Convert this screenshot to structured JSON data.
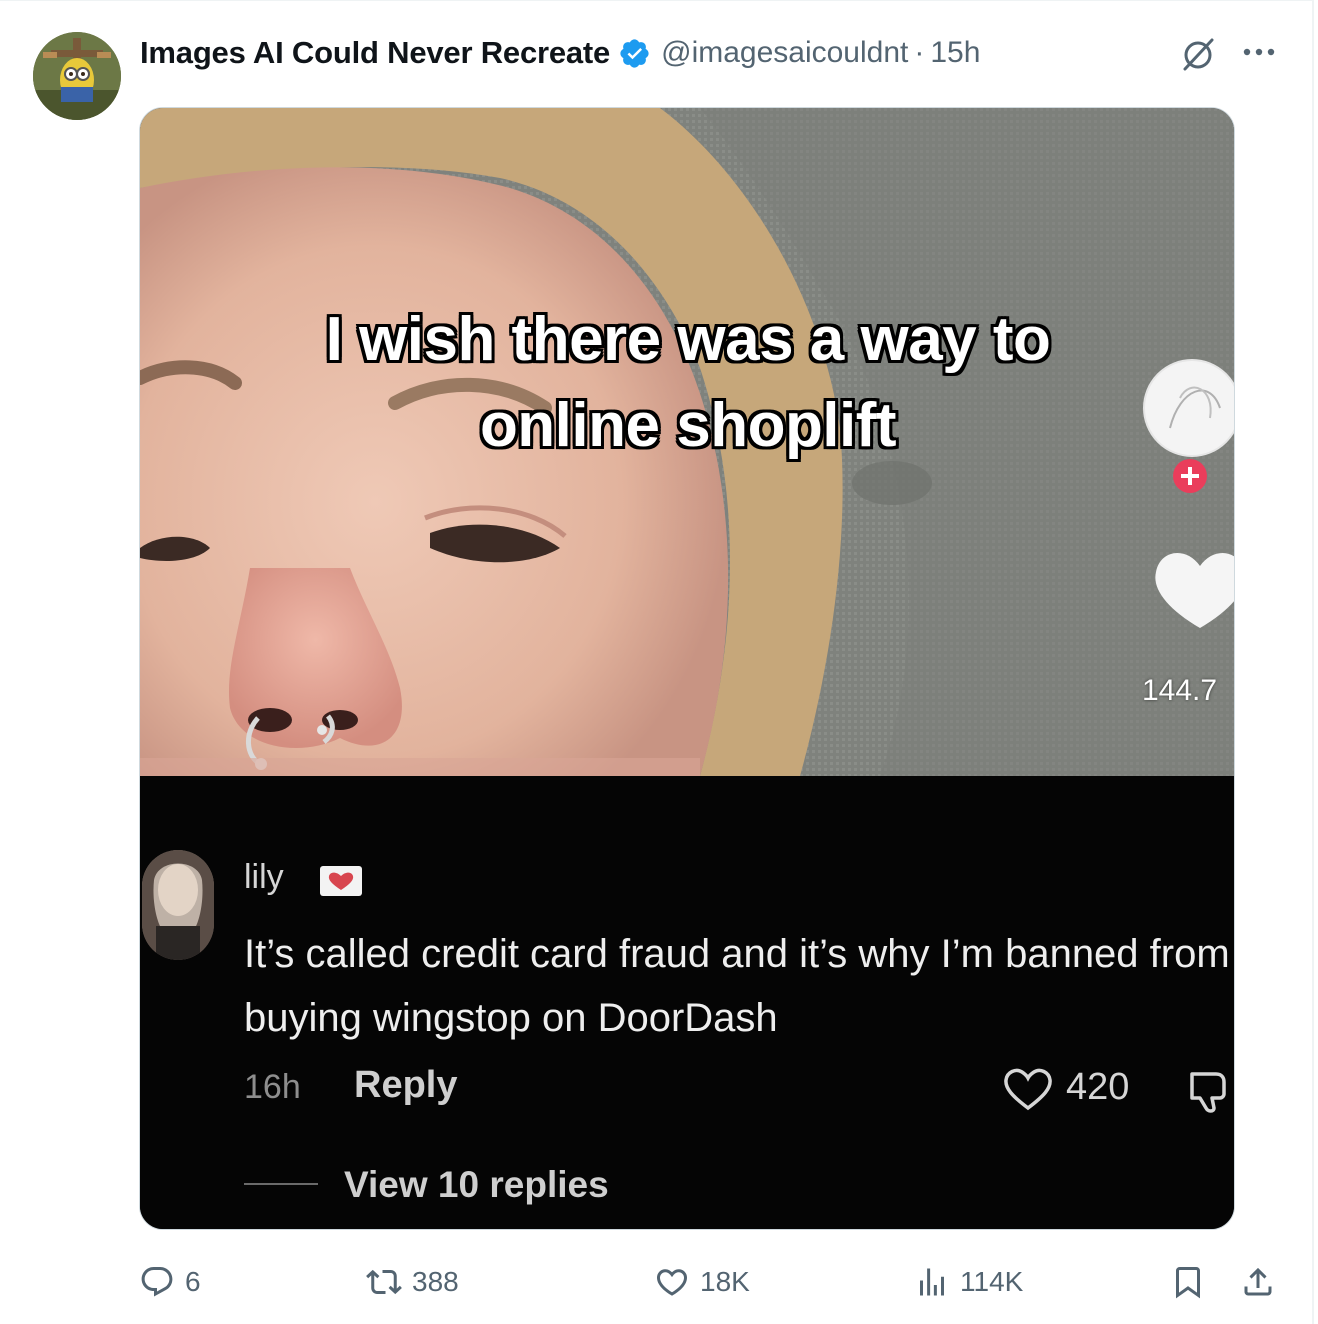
{
  "tweet": {
    "display_name": "Images AI Could Never Recreate",
    "handle": "@imagesaicouldnt",
    "separator": "·",
    "time": "15h"
  },
  "media": {
    "overlay_line1": "I wish there was a way to",
    "overlay_line2": "online shoplift",
    "tiktok_like_count": "144.7",
    "comment": {
      "username": "lily",
      "text": "It’s called credit card fraud and it’s why I’m banned from buying wingstop on DoorDash",
      "age": "16h",
      "reply_label": "Reply",
      "like_count": "420",
      "view_replies": "View 10 replies"
    }
  },
  "actions": {
    "replies": "6",
    "reposts": "388",
    "likes": "18K",
    "views": "114K"
  },
  "colors": {
    "verified_blue": "#1d9bf0",
    "tiktok_plus_red": "#ea3d5b",
    "muted_text": "#536471"
  },
  "icons": [
    "verified-badge-icon",
    "grok-icon",
    "more-icon",
    "reply-icon",
    "repost-icon",
    "like-icon",
    "views-icon",
    "bookmark-icon",
    "share-icon",
    "heart-icon",
    "dislike-icon",
    "plus-icon"
  ]
}
